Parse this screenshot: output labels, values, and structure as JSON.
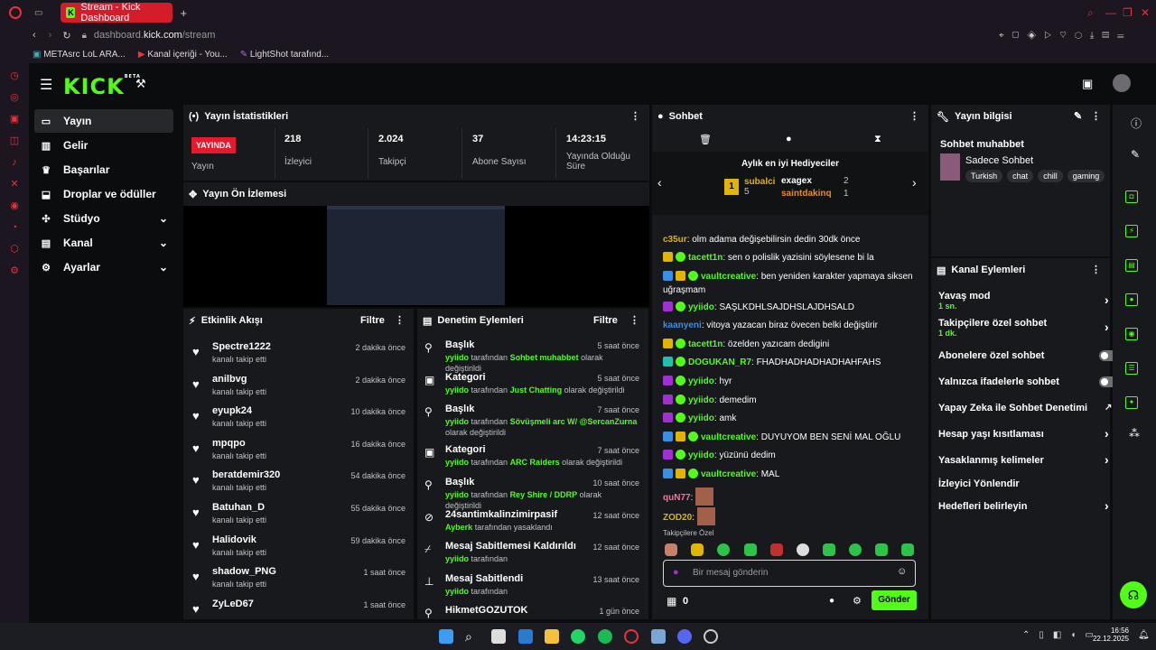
{
  "browser": {
    "tab_title": "Stream - Kick Dashboard",
    "url_host": "dashboard.",
    "url_domain": "kick.com",
    "url_path": "/stream",
    "bookmarks": [
      "METAsrc LoL ARA...",
      "Kanal içeriği - You...",
      "LightShot tarafınd..."
    ]
  },
  "app": {
    "logo": "KICK",
    "logo_sup": "BETA"
  },
  "sidebar": {
    "items": [
      {
        "label": "Yayın"
      },
      {
        "label": "Gelir"
      },
      {
        "label": "Başarılar"
      },
      {
        "label": "Droplar ve ödüller"
      },
      {
        "label": "Stüdyo"
      },
      {
        "label": "Kanal"
      },
      {
        "label": "Ayarlar"
      }
    ]
  },
  "stats": {
    "title": "Yayın İstatistikleri",
    "live_badge": "YAYINDA",
    "live_label": "Yayın",
    "viewers": "218",
    "viewers_label": "İzleyici",
    "followers": "2.024",
    "followers_label": "Takipçi",
    "subs": "37",
    "subs_label": "Abone Sayısı",
    "uptime": "14:23:15",
    "uptime_label": "Yayında Olduğu Süre"
  },
  "preview": {
    "title": "Yayın Ön İzlemesi"
  },
  "activity": {
    "title": "Etkinlik Akışı",
    "filter": "Filtre",
    "rows": [
      {
        "name": "Spectre1222",
        "sub": "kanalı takip etti",
        "time": "2 dakika önce"
      },
      {
        "name": "anilbvg",
        "sub": "kanalı takip etti",
        "time": "2 dakika önce"
      },
      {
        "name": "eyupk24",
        "sub": "kanalı takip etti",
        "time": "10 dakika önce"
      },
      {
        "name": "mpqpo",
        "sub": "kanalı takip etti",
        "time": "16 dakika önce"
      },
      {
        "name": "beratdemir320",
        "sub": "kanalı takip etti",
        "time": "54 dakika önce"
      },
      {
        "name": "Batuhan_D",
        "sub": "kanalı takip etti",
        "time": "55 dakika önce"
      },
      {
        "name": "Halidovik",
        "sub": "kanalı takip etti",
        "time": "59 dakika önce"
      },
      {
        "name": "shadow_PNG",
        "sub": "kanalı takip etti",
        "time": "1 saat önce"
      },
      {
        "name": "ZyLeD67",
        "sub": "",
        "time": "1 saat önce"
      }
    ]
  },
  "moderation": {
    "title": "Denetim Eylemleri",
    "filter": "Filtre",
    "rows": [
      {
        "title": "Başlık",
        "user": "yyiido",
        "mid": " tarafından ",
        "val": "Sohbet muhabbet",
        "end": " olarak değiştirildi",
        "time": "5 saat önce"
      },
      {
        "title": "Kategori",
        "user": "yyiido",
        "mid": " tarafından ",
        "val": "Just Chatting",
        "end": " olarak değiştirildi",
        "time": "5 saat önce"
      },
      {
        "title": "Başlık",
        "user": "yyiido",
        "mid": " tarafından ",
        "val": "Sövüşmeli arc W/ @SercanZurna",
        "end": " olarak değiştirildi",
        "time": "7 saat önce"
      },
      {
        "title": "Kategori",
        "user": "yyiido",
        "mid": " tarafından ",
        "val": "ARC Raiders",
        "end": " olarak değiştirildi",
        "time": "7 saat önce"
      },
      {
        "title": "Başlık",
        "user": "yyiido",
        "mid": " tarafından ",
        "val": "Rey Shire / DDRP",
        "end": " olarak değiştirildi",
        "time": "10 saat önce"
      },
      {
        "title": "24santimkalinzimirpasif",
        "user": "Ayberk",
        "mid": " tarafından yasaklandı",
        "val": "",
        "end": "",
        "time": "12 saat önce"
      },
      {
        "title": "Mesaj Sabitlemesi Kaldırıldı",
        "user": "yyiido",
        "mid": " tarafından",
        "val": "",
        "end": "",
        "time": "12 saat önce"
      },
      {
        "title": "Mesaj Sabitlendi",
        "user": "yyiido",
        "mid": " tarafından",
        "val": "",
        "end": "",
        "time": "13 saat önce"
      },
      {
        "title": "HikmetGOZUTOK",
        "user": "",
        "mid": "",
        "val": "",
        "end": "",
        "time": "1 gün önce"
      }
    ]
  },
  "chat": {
    "title": "Sohbet",
    "gifters_title": "Aylık en iyi Hediyeciler",
    "gifter1": "subalci",
    "gifter1_count": "5",
    "gifter2": "exagex",
    "gifter2_count": "2",
    "gifter3": "saintdakinq",
    "gifter3_count": "1",
    "rank": "1",
    "messages": [
      {
        "user": "c35ur",
        "color": "#e0b400",
        "text": "olm adama değişebilirsin dedin 30dk önce"
      },
      {
        "user": "tacett1n",
        "color": "#53fc18",
        "text": "sen o polislik yazisini söylesene bi la"
      },
      {
        "user": "vaultcreative",
        "color": "#53fc18",
        "text": "ben yeniden karakter yapmaya siksen uğraşmam"
      },
      {
        "user": "yyiido",
        "color": "#53fc18",
        "text": "SAŞLKDHLSAJDHSLAJDHSALD"
      },
      {
        "user": "kaanyeni",
        "color": "#3a8fe0",
        "text": "vitoya yazacan biraz övecen belki değiştirir"
      },
      {
        "user": "tacett1n",
        "color": "#53fc18",
        "text": "özelden yazıcam dedigini"
      },
      {
        "user": "DOGUKAN_R7",
        "color": "#53fc18",
        "text": "FHADHADHADHADHAHFAHS"
      },
      {
        "user": "yyiido",
        "color": "#53fc18",
        "text": "hyr"
      },
      {
        "user": "yyiido",
        "color": "#53fc18",
        "text": "demedim"
      },
      {
        "user": "yyiido",
        "color": "#53fc18",
        "text": "amk"
      },
      {
        "user": "vaultcreative",
        "color": "#53fc18",
        "text": "DUYUYOM BEN SENİ MAL OĞLU"
      },
      {
        "user": "yyiido",
        "color": "#53fc18",
        "text": "yüzünü dedim"
      },
      {
        "user": "vaultcreative",
        "color": "#53fc18",
        "text": "MAL"
      },
      {
        "user": "quN77",
        "color": "#ff6fa0",
        "text": ""
      },
      {
        "user": "ZOD20",
        "color": "#e0b400",
        "text": ""
      }
    ],
    "emote_section": "Takipçilere Özel",
    "input_placeholder": "Bir mesaj gönderin",
    "points": "0",
    "send": "Gönder"
  },
  "stream_info": {
    "title": "Yayın bilgisi",
    "stream_title": "Sohbet muhabbet",
    "category": "Sadece Sohbet",
    "tags": [
      "Turkish",
      "chat",
      "chill",
      "gaming"
    ]
  },
  "channel_actions": {
    "title": "Kanal Eylemleri",
    "items": [
      {
        "label": "Yavaş mod",
        "sub": "1 sn."
      },
      {
        "label": "Takipçilere özel sohbet",
        "sub": "1 dk."
      },
      {
        "label": "Abonelere özel sohbet",
        "sub": ""
      },
      {
        "label": "Yalnızca ifadelerle sohbet",
        "sub": ""
      },
      {
        "label": "Yapay Zeka ile Sohbet Denetimi",
        "sub": ""
      },
      {
        "label": "Hesap yaşı kısıtlaması",
        "sub": ""
      },
      {
        "label": "Yasaklanmış kelimeler",
        "sub": ""
      },
      {
        "label": "İzleyici Yönlendir",
        "sub": ""
      },
      {
        "label": "Hedefleri belirleyin",
        "sub": ""
      }
    ]
  },
  "taskbar": {
    "time": "16:56",
    "date": "22.12.2025"
  },
  "colors": {
    "accent": "#53fc18",
    "live": "#e8192c",
    "panel": "#17191c"
  }
}
